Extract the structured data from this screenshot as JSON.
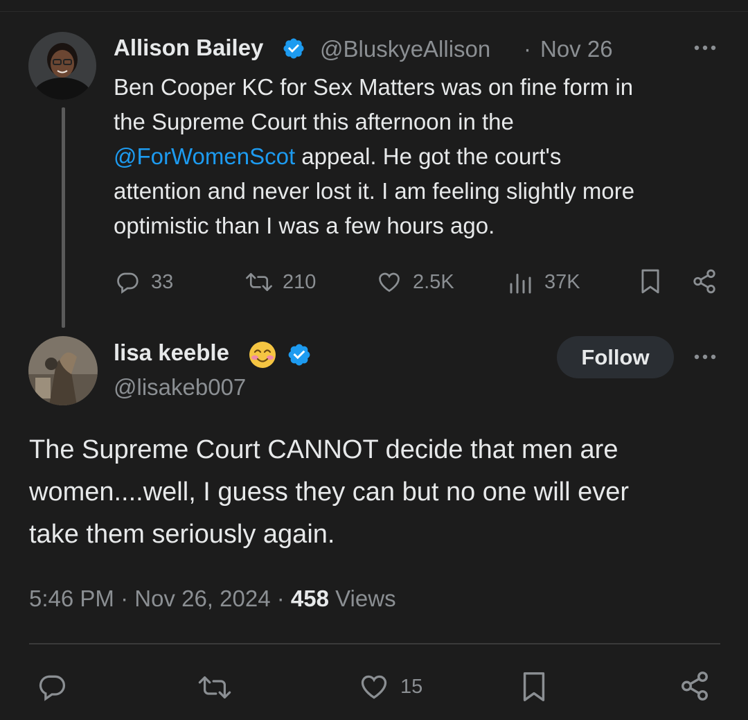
{
  "first_tweet": {
    "author_name": "Allison Bailey",
    "handle": "@BluskyeAllison",
    "separator": "·",
    "date": "Nov 26",
    "text_line1": "Ben Cooper KC for Sex Matters was on fine form in",
    "text_line2": "the Supreme Court this afternoon in the",
    "mention": "@ForWomenScot",
    "text_line3_rest": " appeal. He got the court's",
    "text_line4": "attention and never lost it. I am feeling slightly more",
    "text_line5": "optimistic than I was a few hours ago.",
    "replies": "33",
    "reposts": "210",
    "likes": "2.5K",
    "views": "37K",
    "icons": [
      "reply-icon",
      "repost-icon",
      "like-icon",
      "views-icon",
      "bookmark-icon",
      "share-icon",
      "more-icon",
      "verified-icon"
    ]
  },
  "second_tweet": {
    "author_name": "lisa keeble",
    "emoji": "😊",
    "handle": "@lisakeb007",
    "follow_label": "Follow",
    "text_line1": "The Supreme Court CANNOT decide that men are",
    "text_line2": "women....well, I guess they can but no one will ever",
    "text_line3": "take them seriously again.",
    "time": "5:46 PM",
    "separator": "·",
    "date": "Nov 26, 2024",
    "views_count": "458",
    "views_label": "Views",
    "likes": "15"
  },
  "colors": {
    "background": "#1c1c1c",
    "text": "#e7e9ea",
    "muted": "#8b8f93",
    "accent": "#1d9bf0",
    "verified": "#1d9bf0",
    "follow_button": "#2a2e33"
  }
}
